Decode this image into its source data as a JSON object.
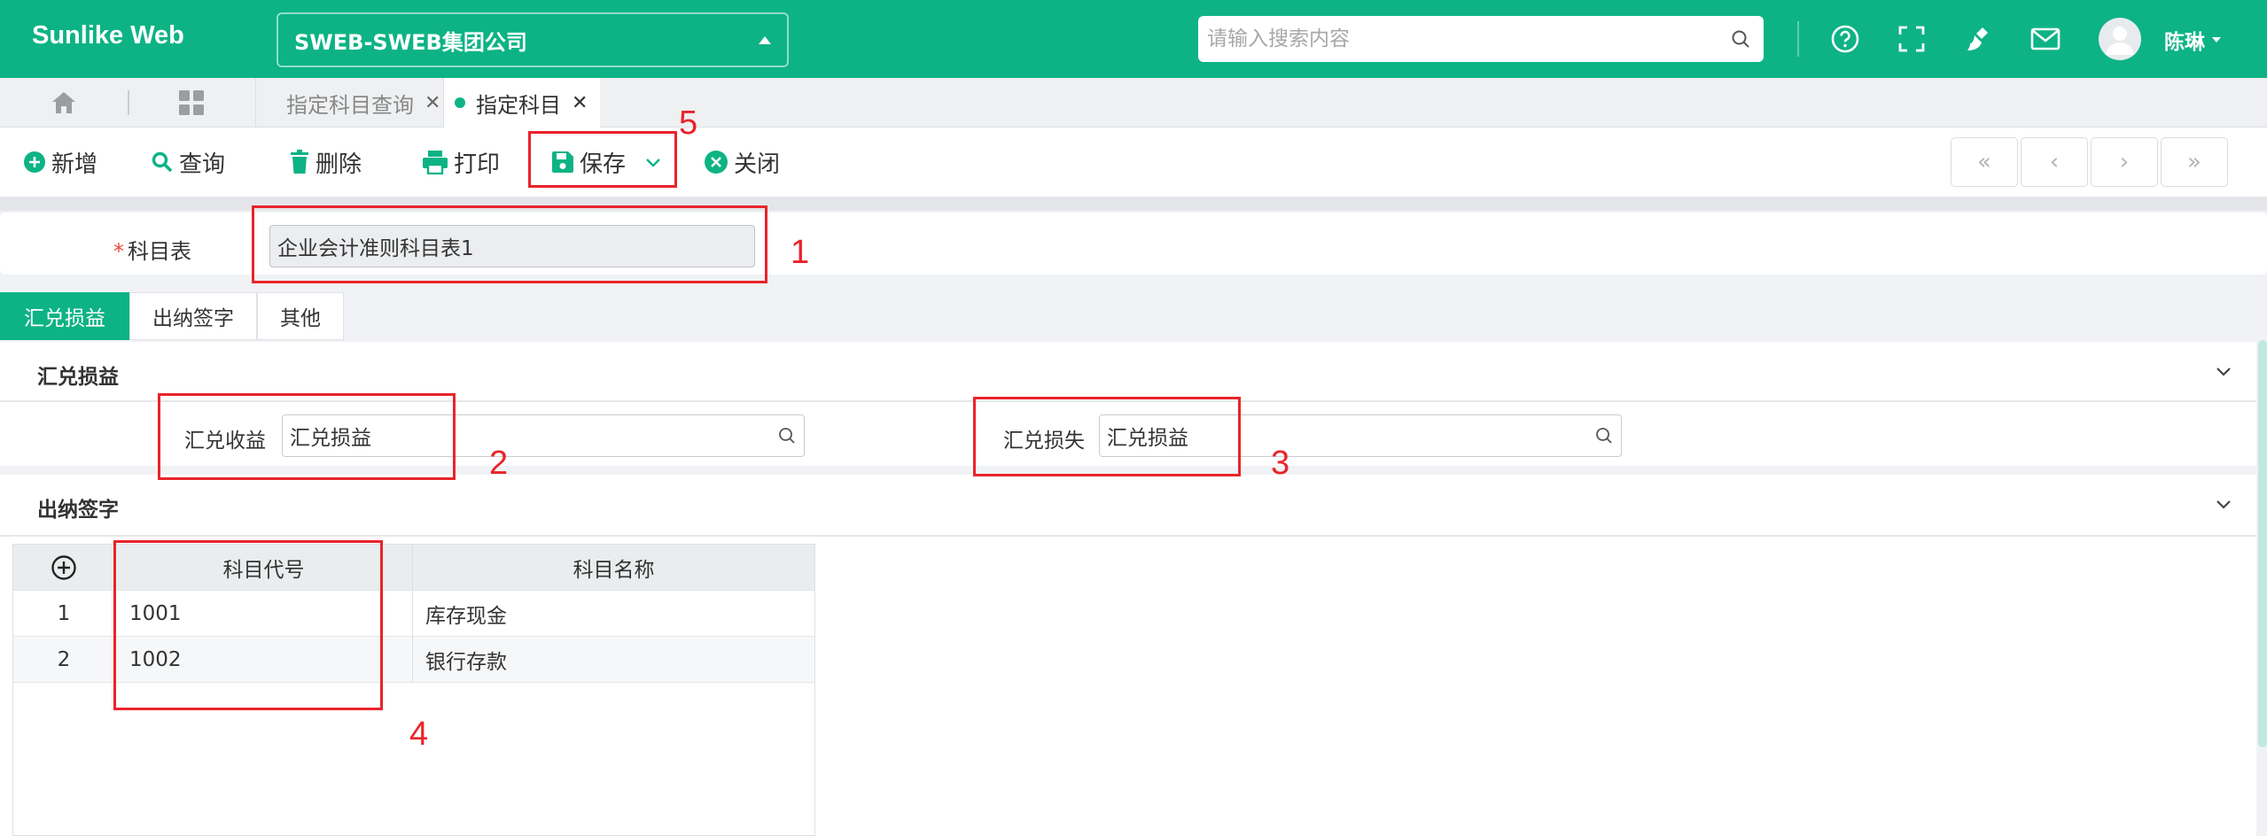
{
  "header": {
    "brand": "Sunlike Web",
    "company": "SWEB-SWEB集团公司",
    "search_placeholder": "请输入搜索内容",
    "user": "陈琳"
  },
  "tabs": [
    {
      "label": "指定科目查询",
      "active": false
    },
    {
      "label": "指定科目",
      "active": true
    }
  ],
  "toolbar": {
    "add": "新增",
    "query": "查询",
    "delete": "删除",
    "print": "打印",
    "save": "保存",
    "close": "关闭",
    "pager": {
      "first": "«",
      "prev": "‹",
      "next": "›",
      "last": "»"
    }
  },
  "form": {
    "required_mark": "*",
    "subject_table_label": "科目表",
    "subject_table_value": "企业会计准则科目表1"
  },
  "section_tabs": [
    "汇兑损益",
    "出纳签字",
    "其他"
  ],
  "exchange_section": {
    "title": "汇兑损益",
    "gain_label": "汇兑收益",
    "gain_value": "汇兑损益",
    "loss_label": "汇兑损失",
    "loss_value": "汇兑损益"
  },
  "cashier_section": {
    "title": "出纳签字",
    "columns": [
      "科目代号",
      "科目名称"
    ],
    "rows": [
      {
        "index": "1",
        "code": "1001",
        "name": "库存现金"
      },
      {
        "index": "2",
        "code": "1002",
        "name": "银行存款"
      }
    ]
  },
  "annotations": [
    "1",
    "2",
    "3",
    "4",
    "5"
  ],
  "colors": {
    "primary": "#0db385",
    "annotation": "#e8242a"
  },
  "icons": [
    "question-icon",
    "fullscreen-icon",
    "broom-icon",
    "mail-icon",
    "home-icon",
    "grid-icon",
    "search-icon",
    "chevron-down-icon",
    "plus-circle-icon"
  ]
}
